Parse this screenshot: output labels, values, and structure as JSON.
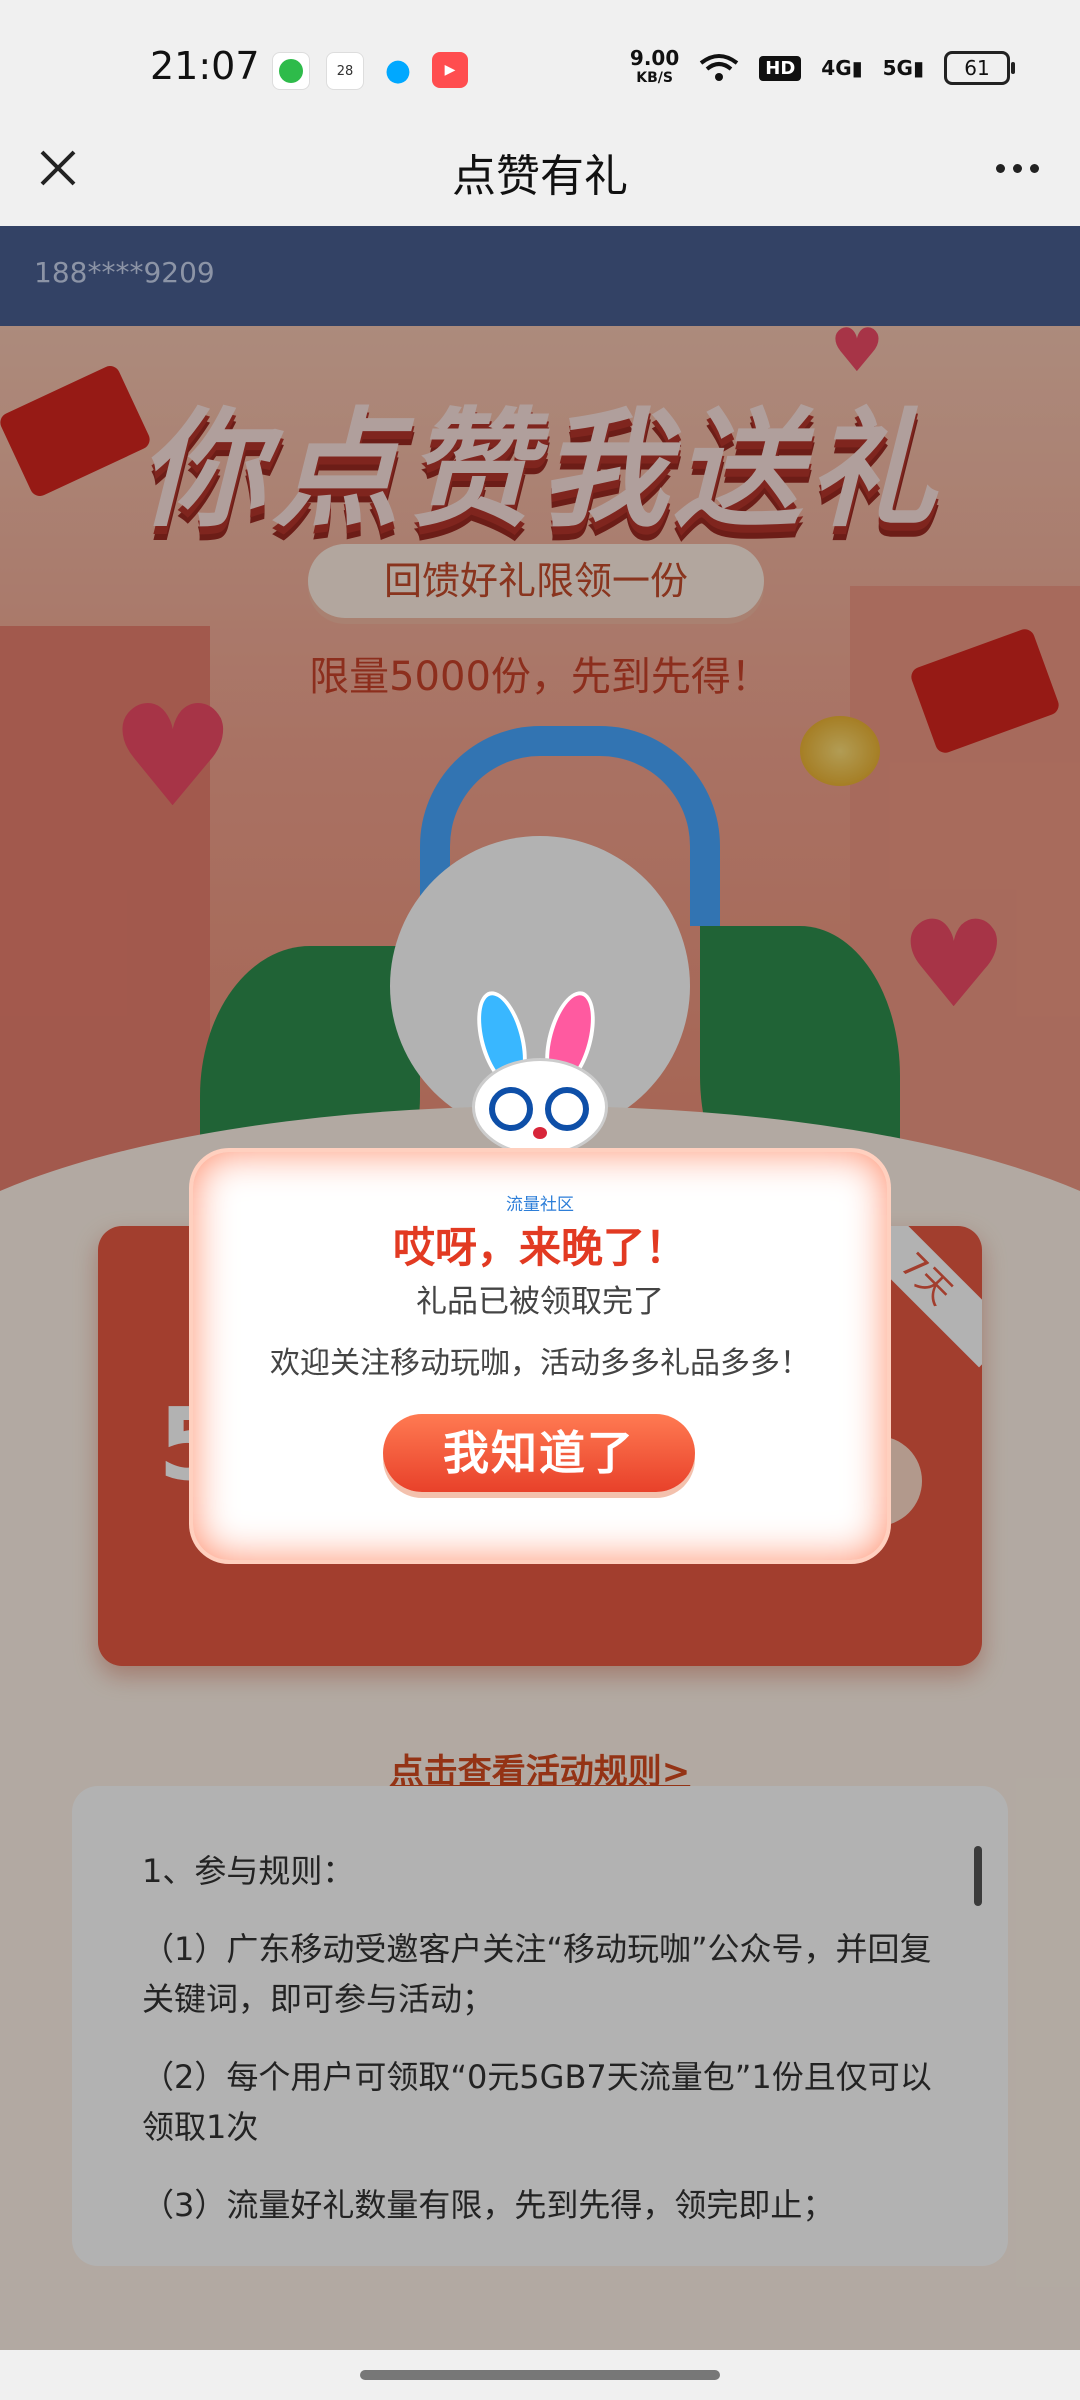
{
  "status": {
    "time": "21:07",
    "calendar_day": "28",
    "net_speed": "9.00",
    "net_unit": "KB/S",
    "hd": "HD",
    "signal1": "4G",
    "signal2": "5G",
    "battery": "61"
  },
  "nav": {
    "title": "点赞有礼"
  },
  "user": {
    "phone": "188****9209"
  },
  "hero": {
    "title": "你点赞我送礼",
    "pill": "回馈好礼限领一份",
    "subtitle": "限量5000份，先到先得！"
  },
  "gift": {
    "ribbon": "7天",
    "big": "5"
  },
  "rules": {
    "link": "点击查看活动规则>",
    "heading": "1、参与规则：",
    "items": [
      "（1）广东移动受邀客户关注“移动玩咖”公众号，并回复关键词，即可参与活动；",
      "（2）每个用户可领取“0元5GB7天流量包”1份且仅可以领取1次",
      "（3）流量好礼数量有限，先到先得，领完即止；"
    ]
  },
  "modal": {
    "brand": "流量社区",
    "title": "哎呀，来晚了！",
    "msg1": "礼品已被领取完了",
    "msg2": "欢迎关注移动玩咖，活动多多礼品多多！",
    "button": "我知道了"
  }
}
